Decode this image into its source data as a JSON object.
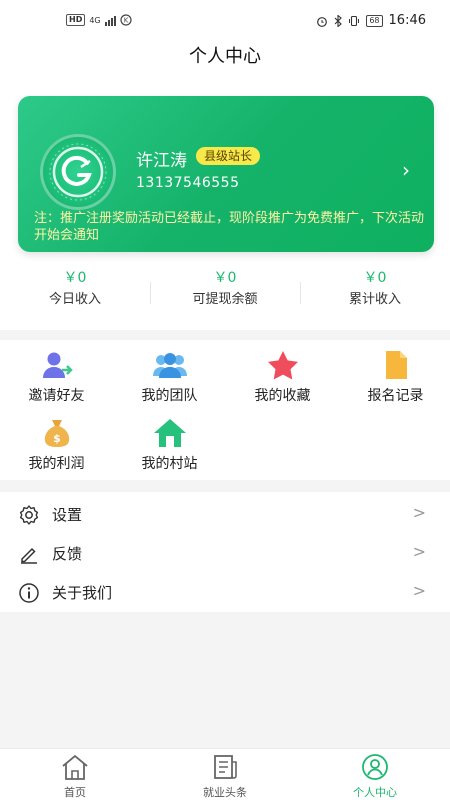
{
  "status_bar": {
    "left_badges": [
      "HD",
      "4G"
    ],
    "time": "16:46",
    "battery": "68"
  },
  "header": {
    "title": "个人中心"
  },
  "profile_card": {
    "name": "许江涛",
    "role": "县级站长",
    "phone": "13137546555",
    "arrow": "›",
    "notice": "注：推广注册奖励活动已经截止，现阶段推广为免费推广，下次活动开始会通知",
    "accent": "#15b36a"
  },
  "stats": [
    {
      "value": "￥0",
      "label": "今日收入"
    },
    {
      "value": "￥0",
      "label": "可提现余额"
    },
    {
      "value": "￥0",
      "label": "累计收入"
    }
  ],
  "grid": [
    {
      "label": "邀请好友",
      "icon": "invite-user-icon"
    },
    {
      "label": "我的团队",
      "icon": "team-icon"
    },
    {
      "label": "我的收藏",
      "icon": "star-icon"
    },
    {
      "label": "报名记录",
      "icon": "document-icon"
    },
    {
      "label": "我的利润",
      "icon": "money-bag-icon"
    },
    {
      "label": "我的村站",
      "icon": "home-icon"
    }
  ],
  "menu": [
    {
      "label": "设置",
      "icon": "gear-icon",
      "arrow": ">"
    },
    {
      "label": "反馈",
      "icon": "pencil-icon",
      "arrow": ">"
    },
    {
      "label": "关于我们",
      "icon": "info-icon",
      "arrow": ">"
    }
  ],
  "tabbar": [
    {
      "label": "首页",
      "icon": "home-icon",
      "active": false
    },
    {
      "label": "就业头条",
      "icon": "news-icon",
      "active": false
    },
    {
      "label": "个人中心",
      "icon": "user-icon",
      "active": true
    }
  ],
  "colors": {
    "brand_green": "#1cb86f",
    "badge_yellow": "#f7e94a",
    "notice_text": "#fff3a6"
  }
}
